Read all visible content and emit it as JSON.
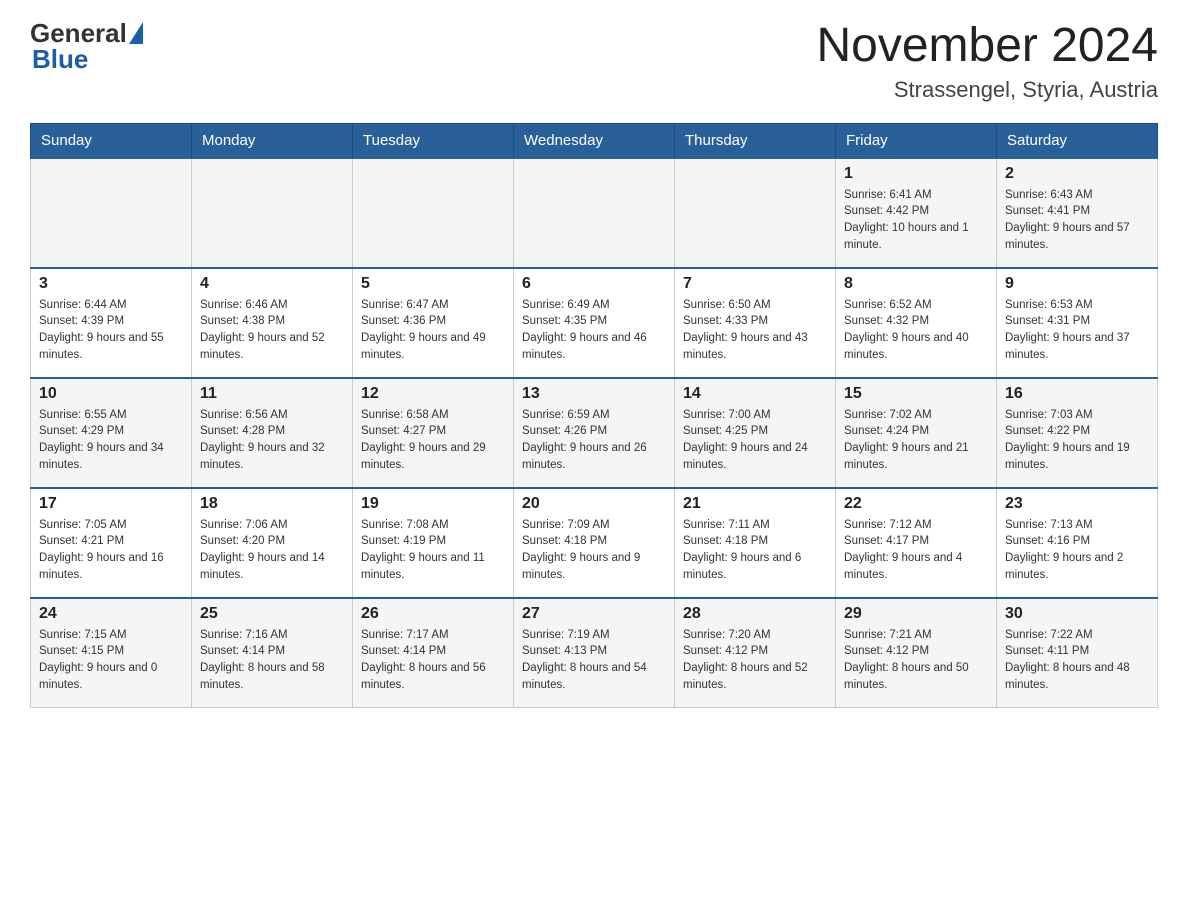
{
  "header": {
    "logo_general": "General",
    "logo_blue": "Blue",
    "month_title": "November 2024",
    "location": "Strassengel, Styria, Austria"
  },
  "weekdays": [
    "Sunday",
    "Monday",
    "Tuesday",
    "Wednesday",
    "Thursday",
    "Friday",
    "Saturday"
  ],
  "weeks": [
    {
      "days": [
        {
          "num": "",
          "info": ""
        },
        {
          "num": "",
          "info": ""
        },
        {
          "num": "",
          "info": ""
        },
        {
          "num": "",
          "info": ""
        },
        {
          "num": "",
          "info": ""
        },
        {
          "num": "1",
          "info": "Sunrise: 6:41 AM\nSunset: 4:42 PM\nDaylight: 10 hours and 1 minute."
        },
        {
          "num": "2",
          "info": "Sunrise: 6:43 AM\nSunset: 4:41 PM\nDaylight: 9 hours and 57 minutes."
        }
      ]
    },
    {
      "days": [
        {
          "num": "3",
          "info": "Sunrise: 6:44 AM\nSunset: 4:39 PM\nDaylight: 9 hours and 55 minutes."
        },
        {
          "num": "4",
          "info": "Sunrise: 6:46 AM\nSunset: 4:38 PM\nDaylight: 9 hours and 52 minutes."
        },
        {
          "num": "5",
          "info": "Sunrise: 6:47 AM\nSunset: 4:36 PM\nDaylight: 9 hours and 49 minutes."
        },
        {
          "num": "6",
          "info": "Sunrise: 6:49 AM\nSunset: 4:35 PM\nDaylight: 9 hours and 46 minutes."
        },
        {
          "num": "7",
          "info": "Sunrise: 6:50 AM\nSunset: 4:33 PM\nDaylight: 9 hours and 43 minutes."
        },
        {
          "num": "8",
          "info": "Sunrise: 6:52 AM\nSunset: 4:32 PM\nDaylight: 9 hours and 40 minutes."
        },
        {
          "num": "9",
          "info": "Sunrise: 6:53 AM\nSunset: 4:31 PM\nDaylight: 9 hours and 37 minutes."
        }
      ]
    },
    {
      "days": [
        {
          "num": "10",
          "info": "Sunrise: 6:55 AM\nSunset: 4:29 PM\nDaylight: 9 hours and 34 minutes."
        },
        {
          "num": "11",
          "info": "Sunrise: 6:56 AM\nSunset: 4:28 PM\nDaylight: 9 hours and 32 minutes."
        },
        {
          "num": "12",
          "info": "Sunrise: 6:58 AM\nSunset: 4:27 PM\nDaylight: 9 hours and 29 minutes."
        },
        {
          "num": "13",
          "info": "Sunrise: 6:59 AM\nSunset: 4:26 PM\nDaylight: 9 hours and 26 minutes."
        },
        {
          "num": "14",
          "info": "Sunrise: 7:00 AM\nSunset: 4:25 PM\nDaylight: 9 hours and 24 minutes."
        },
        {
          "num": "15",
          "info": "Sunrise: 7:02 AM\nSunset: 4:24 PM\nDaylight: 9 hours and 21 minutes."
        },
        {
          "num": "16",
          "info": "Sunrise: 7:03 AM\nSunset: 4:22 PM\nDaylight: 9 hours and 19 minutes."
        }
      ]
    },
    {
      "days": [
        {
          "num": "17",
          "info": "Sunrise: 7:05 AM\nSunset: 4:21 PM\nDaylight: 9 hours and 16 minutes."
        },
        {
          "num": "18",
          "info": "Sunrise: 7:06 AM\nSunset: 4:20 PM\nDaylight: 9 hours and 14 minutes."
        },
        {
          "num": "19",
          "info": "Sunrise: 7:08 AM\nSunset: 4:19 PM\nDaylight: 9 hours and 11 minutes."
        },
        {
          "num": "20",
          "info": "Sunrise: 7:09 AM\nSunset: 4:18 PM\nDaylight: 9 hours and 9 minutes."
        },
        {
          "num": "21",
          "info": "Sunrise: 7:11 AM\nSunset: 4:18 PM\nDaylight: 9 hours and 6 minutes."
        },
        {
          "num": "22",
          "info": "Sunrise: 7:12 AM\nSunset: 4:17 PM\nDaylight: 9 hours and 4 minutes."
        },
        {
          "num": "23",
          "info": "Sunrise: 7:13 AM\nSunset: 4:16 PM\nDaylight: 9 hours and 2 minutes."
        }
      ]
    },
    {
      "days": [
        {
          "num": "24",
          "info": "Sunrise: 7:15 AM\nSunset: 4:15 PM\nDaylight: 9 hours and 0 minutes."
        },
        {
          "num": "25",
          "info": "Sunrise: 7:16 AM\nSunset: 4:14 PM\nDaylight: 8 hours and 58 minutes."
        },
        {
          "num": "26",
          "info": "Sunrise: 7:17 AM\nSunset: 4:14 PM\nDaylight: 8 hours and 56 minutes."
        },
        {
          "num": "27",
          "info": "Sunrise: 7:19 AM\nSunset: 4:13 PM\nDaylight: 8 hours and 54 minutes."
        },
        {
          "num": "28",
          "info": "Sunrise: 7:20 AM\nSunset: 4:12 PM\nDaylight: 8 hours and 52 minutes."
        },
        {
          "num": "29",
          "info": "Sunrise: 7:21 AM\nSunset: 4:12 PM\nDaylight: 8 hours and 50 minutes."
        },
        {
          "num": "30",
          "info": "Sunrise: 7:22 AM\nSunset: 4:11 PM\nDaylight: 8 hours and 48 minutes."
        }
      ]
    }
  ]
}
